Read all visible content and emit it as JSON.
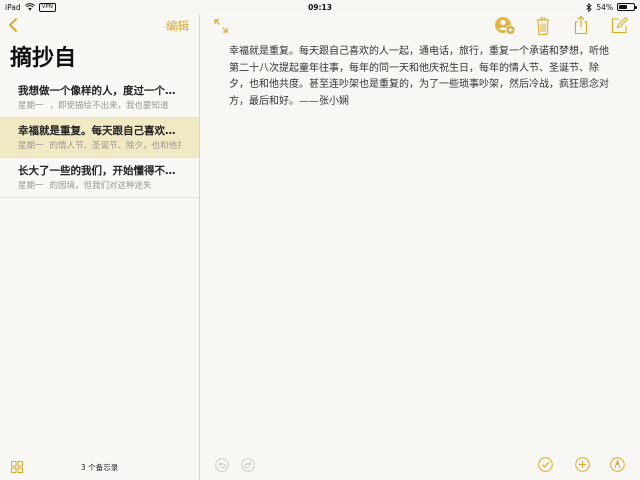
{
  "status_bar": {
    "device": "iPad",
    "vpn": "VPN",
    "time": "09:13",
    "battery_text": "54%",
    "battery_level": 0.54
  },
  "sidebar": {
    "edit_label": "编辑",
    "title": "摘抄自",
    "notes": [
      {
        "title": "我想做一个像样的人，度过一个像样的一生",
        "date": "星期一",
        "preview": "，即使描绘不出来，我也要知道"
      },
      {
        "title": "幸福就是重复。每天跟自己喜欢的人一起",
        "date": "星期一",
        "preview": "的情人节、圣诞节、除夕，也和他共度"
      },
      {
        "title": "长大了一些的我们，开始懂得不去为难",
        "date": "星期一",
        "preview": "的困境，但我们对这种迷失"
      }
    ],
    "footer_count": "3 个备忘录"
  },
  "note": {
    "body": "幸福就是重复。每天跟自己喜欢的人一起，通电话，旅行，重复一个承诺和梦想，听他第二十八次提起童年往事，每年的同一天和他庆祝生日，每年的情人节、圣诞节、除夕，也和他共度。甚至连吵架也是重复的，为了一些琐事吵架，然后冷战，疯狂思念对方，最后和好。——张小娴"
  },
  "colors": {
    "accent": "#d9a928",
    "selected_row": "#f1e8c4",
    "background": "#f8f7f3"
  },
  "icons": [
    "back-chevron-icon",
    "grid-icon",
    "expand-icon",
    "person-add-icon",
    "trash-icon",
    "share-icon",
    "compose-icon",
    "undo-icon",
    "redo-icon",
    "checklist-icon",
    "add-icon",
    "sketch-icon"
  ]
}
